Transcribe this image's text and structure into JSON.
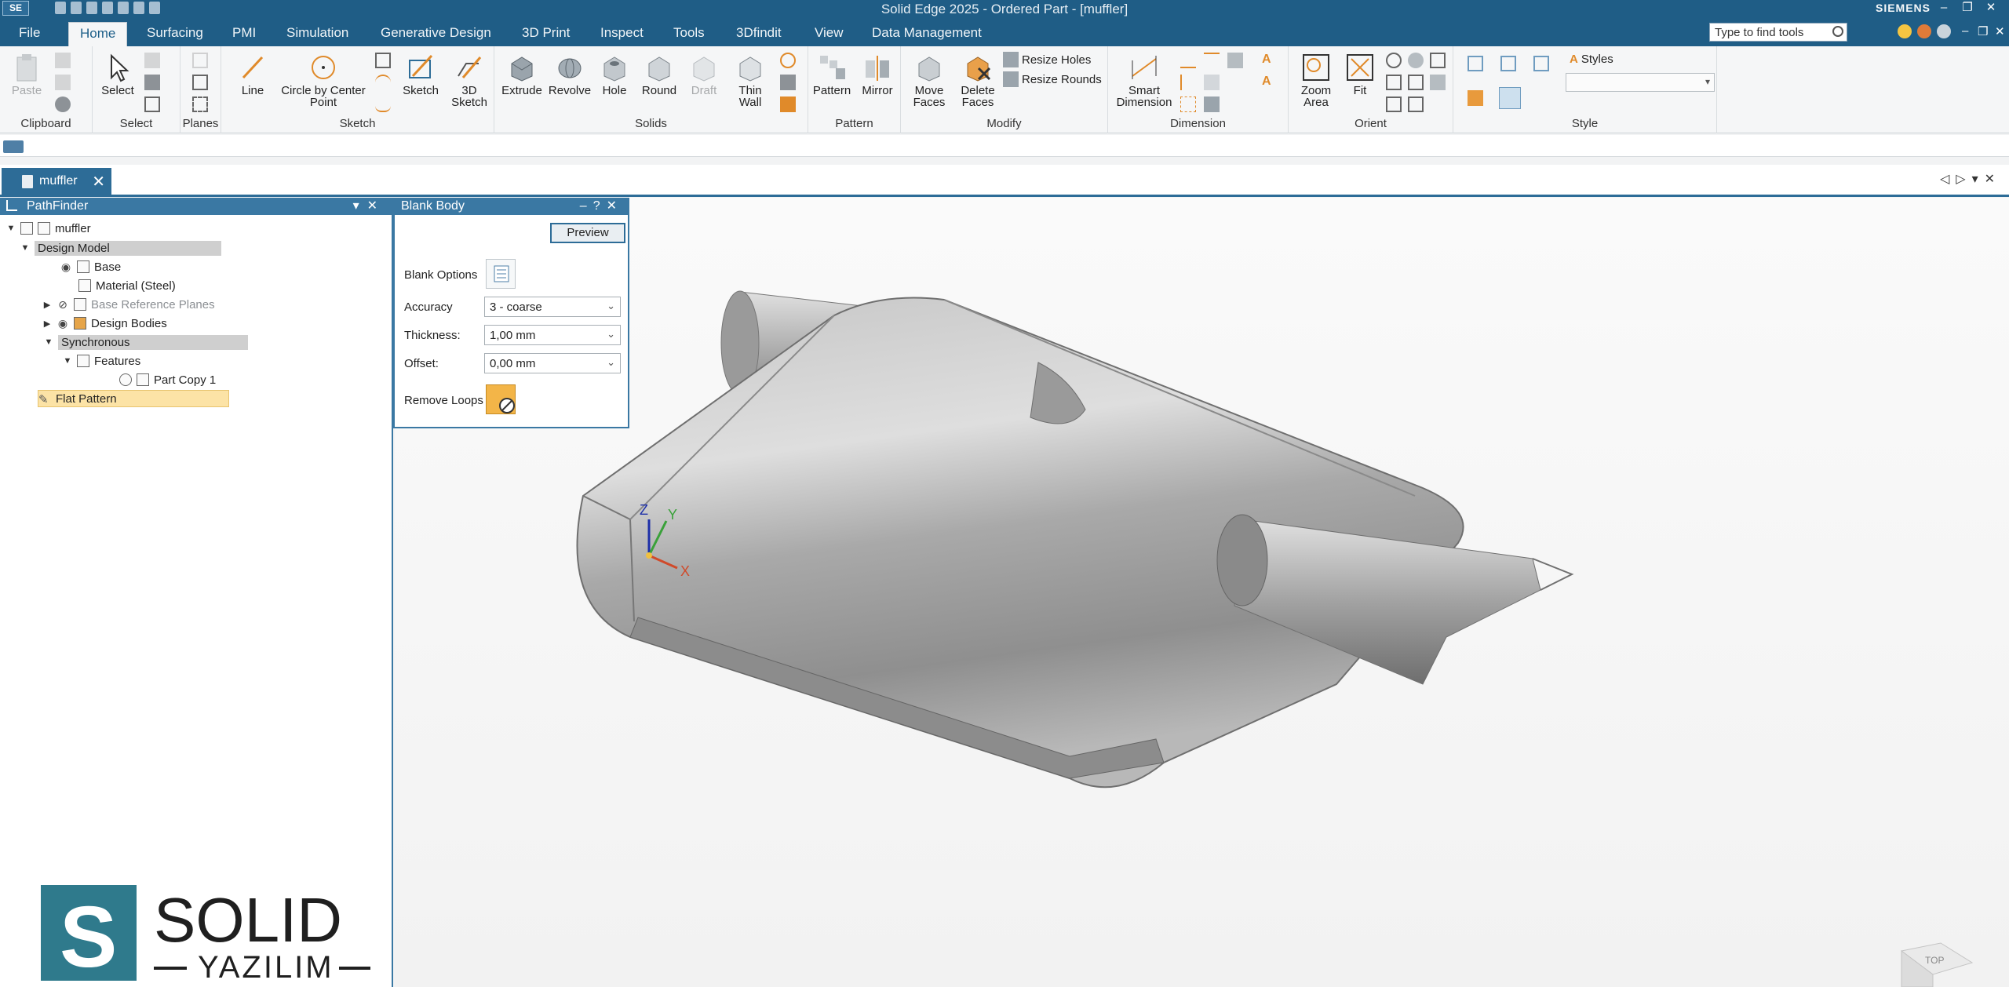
{
  "titlebar": {
    "logo": "SE",
    "title": "Solid Edge 2025 - Ordered Part - [muffler]",
    "brand": "SIEMENS"
  },
  "ribbon_tabs": [
    "File",
    "Home",
    "Surfacing",
    "PMI",
    "Simulation",
    "Generative Design",
    "3D Print",
    "Inspect",
    "Tools",
    "3Dfindit",
    "View",
    "Data Management"
  ],
  "active_tab": "Home",
  "search": {
    "placeholder": "Type to find tools"
  },
  "ribbon": {
    "clipboard": {
      "label": "Clipboard",
      "paste": "Paste"
    },
    "select": {
      "label": "Select",
      "select_btn": "Select"
    },
    "planes": {
      "label": "Planes"
    },
    "sketch": {
      "label": "Sketch",
      "line": "Line",
      "circle": "Circle by Center Point",
      "sketch_btn": "Sketch",
      "sketch3d": "3D Sketch"
    },
    "solids": {
      "label": "Solids",
      "extrude": "Extrude",
      "revolve": "Revolve",
      "hole": "Hole",
      "round": "Round",
      "draft": "Draft",
      "thinwall": "Thin Wall"
    },
    "pattern": {
      "label": "Pattern",
      "pattern_btn": "Pattern",
      "mirror": "Mirror"
    },
    "modify": {
      "label": "Modify",
      "move_faces": "Move Faces",
      "delete_faces": "Delete Faces",
      "resize_holes": "Resize Holes",
      "resize_rounds": "Resize Rounds"
    },
    "dimension": {
      "label": "Dimension",
      "smart": "Smart Dimension"
    },
    "orient": {
      "label": "Orient",
      "zoom_area": "Zoom Area",
      "fit": "Fit"
    },
    "style": {
      "label": "Style",
      "styles": "Styles",
      "selected": ""
    }
  },
  "document_tab": "muffler",
  "pathfinder": {
    "title": "PathFinder",
    "tree": [
      {
        "label": "muffler"
      },
      {
        "label": "Design Model"
      },
      {
        "label": "Base"
      },
      {
        "label": "Material (Steel)"
      },
      {
        "label": "Base Reference Planes"
      },
      {
        "label": "Design Bodies"
      },
      {
        "label": "Synchronous"
      },
      {
        "label": "Features"
      },
      {
        "label": "Part Copy 1"
      },
      {
        "label": "Flat Pattern"
      }
    ]
  },
  "blank_body": {
    "title": "Blank Body",
    "preview": "Preview",
    "blank_options": "Blank Options",
    "accuracy_label": "Accuracy",
    "accuracy_value": "3 - coarse",
    "thickness_label": "Thickness:",
    "thickness_value": "1,00 mm",
    "offset_label": "Offset:",
    "offset_value": "0,00 mm",
    "remove_loops": "Remove Loops"
  },
  "triad": {
    "x": "X",
    "y": "Y",
    "z": "Z"
  },
  "view_cube": "TOP",
  "watermark": {
    "letter": "S",
    "name": "SOLID",
    "sub": "YAZILIM"
  },
  "colors": {
    "accent": "#1f5d86",
    "panel_header": "#3a78a3",
    "selection": "#fce3a6"
  }
}
